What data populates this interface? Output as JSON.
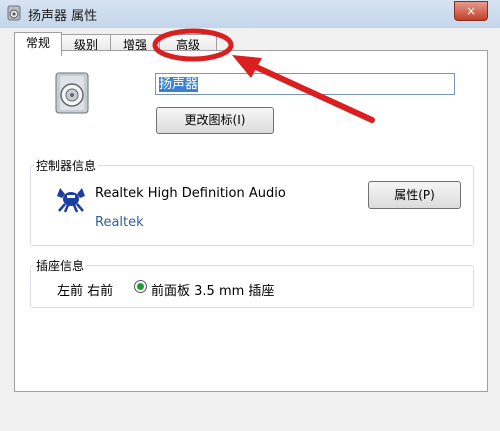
{
  "window": {
    "title": "扬声器 属性",
    "close_symbol": "×"
  },
  "tabs": [
    {
      "label": "常规",
      "active": true
    },
    {
      "label": "级别",
      "active": false
    },
    {
      "label": "增强",
      "active": false
    },
    {
      "label": "高级",
      "active": false
    }
  ],
  "general": {
    "device_name": "扬声器",
    "change_icon_button": "更改图标(I)",
    "controller_section": "控制器信息",
    "controller_name": "Realtek High Definition Audio",
    "controller_vendor": "Realtek",
    "properties_button": "属性(P)",
    "jack_section": "插座信息",
    "jack_position": "左前 右前",
    "jack_description": "前面板 3.5 mm 插座"
  },
  "colors": {
    "annotation_red": "#d91f1f"
  },
  "icons": {
    "window_icon": "speaker-icon",
    "device_icon": "speaker-icon",
    "controller_icon": "realtek-crab-icon"
  }
}
